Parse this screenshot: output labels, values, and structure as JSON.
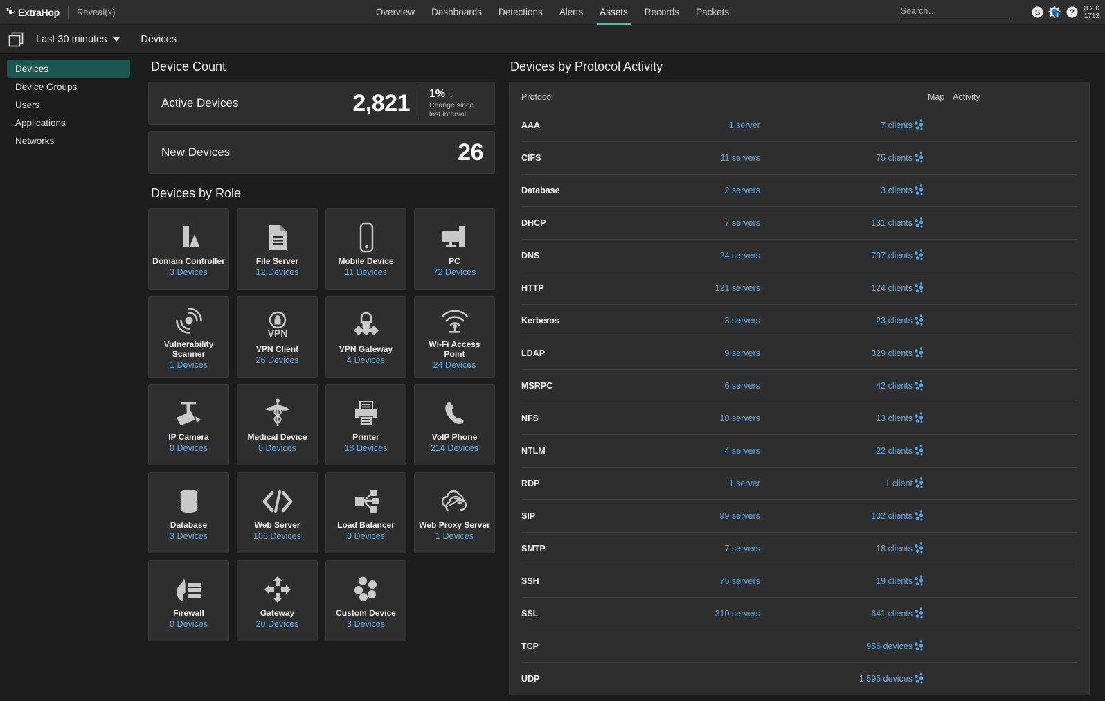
{
  "topnav": {
    "brand": "ExtraHop",
    "product": "Reveal(x)",
    "tabs": [
      {
        "label": "Overview",
        "active": false
      },
      {
        "label": "Dashboards",
        "active": false
      },
      {
        "label": "Detections",
        "active": false
      },
      {
        "label": "Alerts",
        "active": false
      },
      {
        "label": "Assets",
        "active": true
      },
      {
        "label": "Records",
        "active": false
      },
      {
        "label": "Packets",
        "active": false
      }
    ],
    "search_placeholder": "Search…",
    "icons": [
      "s-circle-icon",
      "gear-info-icon",
      "help-icon"
    ],
    "version_line1": "8.2.0",
    "version_line2": "1712",
    "accent_color": "#3dc3bd"
  },
  "subbar": {
    "window_icon": "dual-pane-icon",
    "time_range": "Last 30 minutes",
    "page_title": "Devices"
  },
  "sidebar": {
    "items": [
      {
        "label": "Devices",
        "active": true
      },
      {
        "label": "Device Groups",
        "active": false
      },
      {
        "label": "Users",
        "active": false
      },
      {
        "label": "Applications",
        "active": false
      },
      {
        "label": "Networks",
        "active": false
      }
    ],
    "active_color": "#1b5750"
  },
  "device_count": {
    "title": "Device Count",
    "rows": [
      {
        "label": "Active Devices",
        "value": "2,821",
        "delta": "1% ↓",
        "delta_note_line1": "Change since",
        "delta_note_line2": "last interval"
      },
      {
        "label": "New Devices",
        "value": "26"
      }
    ]
  },
  "devices_by_role": {
    "title": "Devices by Role",
    "link_color": "#5aa7e8",
    "cards": [
      {
        "name": "Domain Controller",
        "count": "3 Devices",
        "icon": "domain-controller-icon"
      },
      {
        "name": "File Server",
        "count": "12 Devices",
        "icon": "file-server-icon"
      },
      {
        "name": "Mobile Device",
        "count": "11 Devices",
        "icon": "mobile-device-icon"
      },
      {
        "name": "PC",
        "count": "72 Devices",
        "icon": "pc-icon"
      },
      {
        "name": "Vulnerability Scanner",
        "count": "1 Devices",
        "icon": "vulnerability-scanner-icon"
      },
      {
        "name": "VPN Client",
        "count": "26 Devices",
        "icon": "vpn-client-icon"
      },
      {
        "name": "VPN Gateway",
        "count": "4 Devices",
        "icon": "vpn-gateway-icon"
      },
      {
        "name": "Wi-Fi Access Point",
        "count": "24 Devices",
        "icon": "wifi-access-point-icon"
      },
      {
        "name": "IP Camera",
        "count": "0 Devices",
        "icon": "ip-camera-icon"
      },
      {
        "name": "Medical Device",
        "count": "0 Devices",
        "icon": "medical-device-icon"
      },
      {
        "name": "Printer",
        "count": "18 Devices",
        "icon": "printer-icon"
      },
      {
        "name": "VoIP Phone",
        "count": "214 Devices",
        "icon": "voip-phone-icon"
      },
      {
        "name": "Database",
        "count": "3 Devices",
        "icon": "database-icon"
      },
      {
        "name": "Web Server",
        "count": "106 Devices",
        "icon": "web-server-icon"
      },
      {
        "name": "Load Balancer",
        "count": "0 Devices",
        "icon": "load-balancer-icon"
      },
      {
        "name": "Web Proxy Server",
        "count": "1 Devices",
        "icon": "web-proxy-server-icon"
      },
      {
        "name": "Firewall",
        "count": "0 Devices",
        "icon": "firewall-icon"
      },
      {
        "name": "Gateway",
        "count": "20 Devices",
        "icon": "gateway-icon"
      },
      {
        "name": "Custom Device",
        "count": "3 Devices",
        "icon": "custom-device-icon"
      }
    ]
  },
  "protocol_activity": {
    "title": "Devices by Protocol Activity",
    "columns": [
      "Protocol",
      "",
      "",
      "Map",
      "Activity"
    ],
    "map_icon": "network-map-icon",
    "rows": [
      {
        "protocol": "AAA",
        "servers": "1 server",
        "clients": "7 clients"
      },
      {
        "protocol": "CIFS",
        "servers": "11 servers",
        "clients": "75 clients"
      },
      {
        "protocol": "Database",
        "servers": "2 servers",
        "clients": "3 clients"
      },
      {
        "protocol": "DHCP",
        "servers": "7 servers",
        "clients": "131 clients"
      },
      {
        "protocol": "DNS",
        "servers": "24 servers",
        "clients": "797 clients"
      },
      {
        "protocol": "HTTP",
        "servers": "121 servers",
        "clients": "124 clients"
      },
      {
        "protocol": "Kerberos",
        "servers": "3 servers",
        "clients": "23 clients"
      },
      {
        "protocol": "LDAP",
        "servers": "9 servers",
        "clients": "329 clients"
      },
      {
        "protocol": "MSRPC",
        "servers": "6 servers",
        "clients": "42 clients"
      },
      {
        "protocol": "NFS",
        "servers": "10 servers",
        "clients": "13 clients"
      },
      {
        "protocol": "NTLM",
        "servers": "4 servers",
        "clients": "22 clients"
      },
      {
        "protocol": "RDP",
        "servers": "1 server",
        "clients": "1 client"
      },
      {
        "protocol": "SIP",
        "servers": "99 servers",
        "clients": "102 clients"
      },
      {
        "protocol": "SMTP",
        "servers": "7 servers",
        "clients": "18 clients"
      },
      {
        "protocol": "SSH",
        "servers": "75 servers",
        "clients": "19 clients"
      },
      {
        "protocol": "SSL",
        "servers": "310 servers",
        "clients": "641 clients"
      },
      {
        "protocol": "TCP",
        "servers": "",
        "clients": "956 devices"
      },
      {
        "protocol": "UDP",
        "servers": "",
        "clients": "1,595 devices"
      }
    ]
  }
}
